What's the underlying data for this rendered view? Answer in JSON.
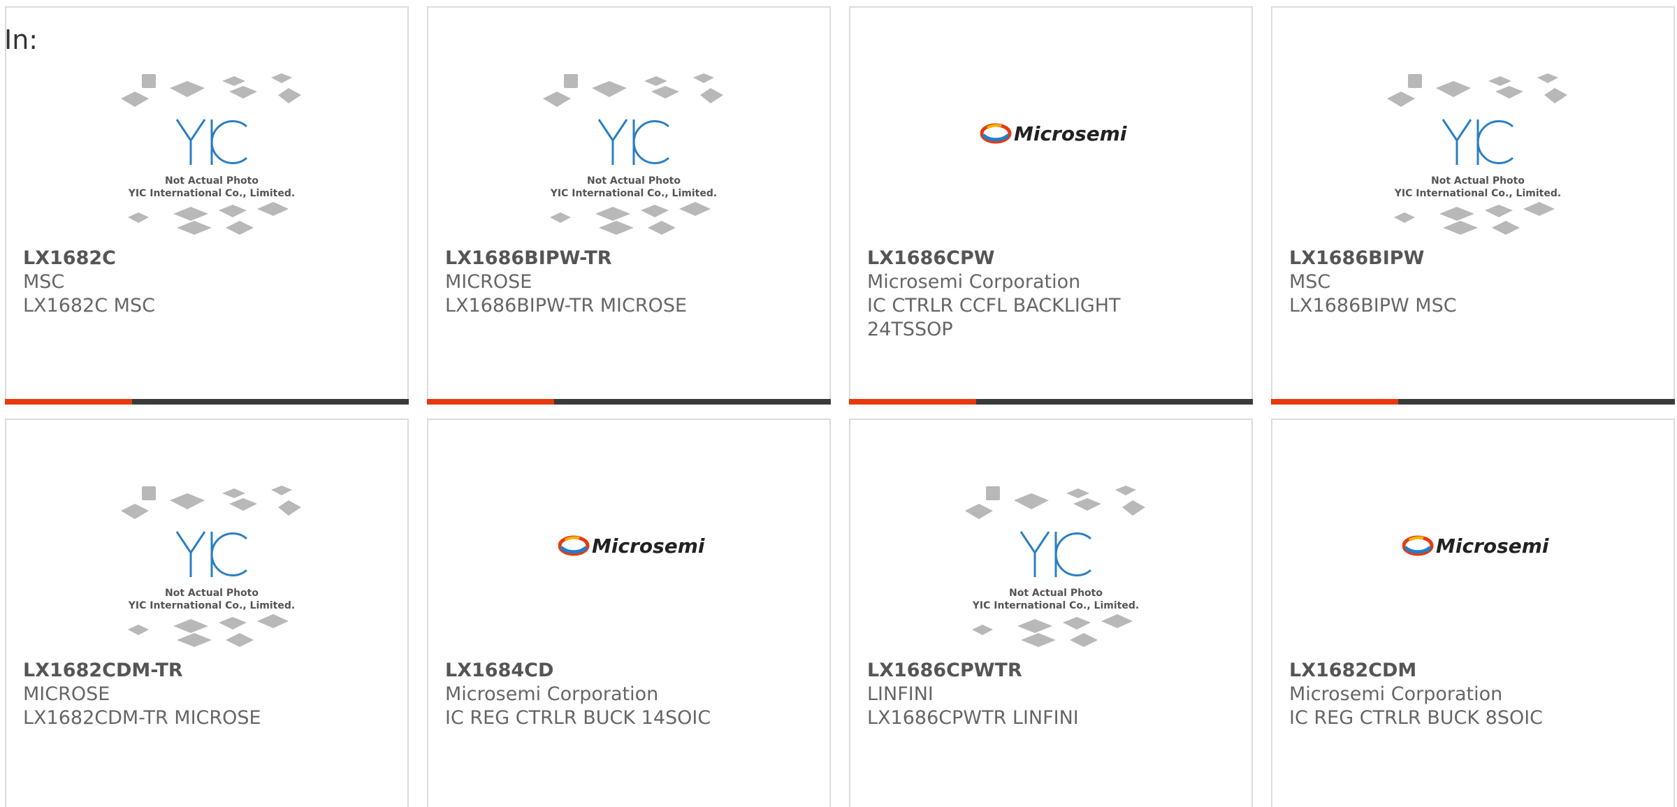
{
  "header": {
    "label": "In:"
  },
  "products": [
    {
      "part": "LX1682C",
      "manufacturer": "MSC",
      "description": "LX1682C MSC",
      "image": "yic-placeholder"
    },
    {
      "part": "LX1686BIPW-TR",
      "manufacturer": "MICROSE",
      "description": "LX1686BIPW-TR MICROSE",
      "image": "yic-placeholder"
    },
    {
      "part": "LX1686CPW",
      "manufacturer": "Microsemi Corporation",
      "description": "IC CTRLR CCFL BACKLIGHT 24TSSOP",
      "image": "microsemi-logo"
    },
    {
      "part": "LX1686BIPW",
      "manufacturer": "MSC",
      "description": "LX1686BIPW MSC",
      "image": "yic-placeholder"
    },
    {
      "part": "LX1682CDM-TR",
      "manufacturer": "MICROSE",
      "description": "LX1682CDM-TR MICROSE",
      "image": "yic-placeholder"
    },
    {
      "part": "LX1684CD",
      "manufacturer": "Microsemi Corporation",
      "description": "IC REG CTRLR BUCK 14SOIC",
      "image": "microsemi-logo"
    },
    {
      "part": "LX1686CPWTR",
      "manufacturer": "LINFINI",
      "description": "LX1686CPWTR LINFINI",
      "image": "yic-placeholder"
    },
    {
      "part": "LX1682CDM",
      "manufacturer": "Microsemi Corporation",
      "description": "IC REG CTRLR BUCK 8SOIC",
      "image": "microsemi-logo"
    }
  ],
  "placeholder": {
    "logo_text": "YIC",
    "caption_line1": "Not Actual Photo",
    "caption_line2": "YIC International Co., Limited."
  },
  "microsemi": {
    "logo_text": "Microsemi"
  },
  "colors": {
    "accent": "#e8380d",
    "bar": "#3a3a3a",
    "border": "#dcdcdc",
    "text": "#666666",
    "yic_blue": "#2a7fc4"
  }
}
